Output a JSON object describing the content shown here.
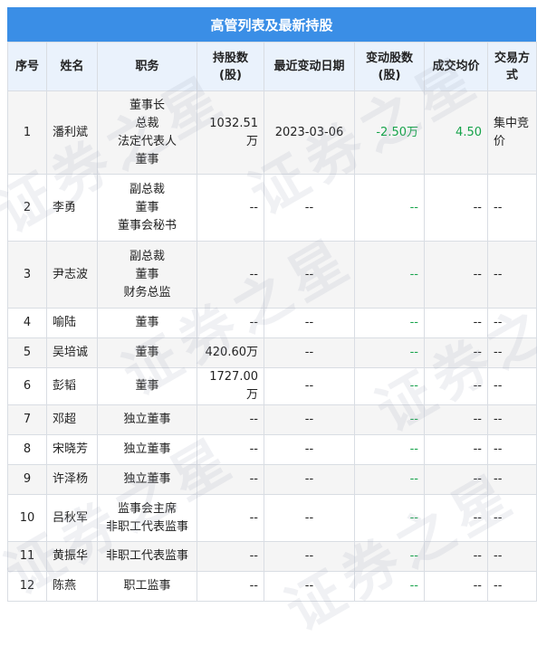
{
  "title": "高管列表及最新持股",
  "headers": {
    "idx": "序号",
    "name": "姓名",
    "position": "职务",
    "holding_l1": "持股数",
    "holding_l2": "(股)",
    "date": "最近变动日期",
    "change_l1": "变动股数",
    "change_l2": "(股)",
    "price": "成交均价",
    "method": "交易方式"
  },
  "rows": [
    {
      "idx": "1",
      "name": "潘利斌",
      "positions": [
        "董事长",
        "总裁",
        "法定代表人",
        "董事"
      ],
      "holding": "1032.51万",
      "date": "2023-03-06",
      "change": "-2.50万",
      "price": "4.50",
      "method": "集中竞价"
    },
    {
      "idx": "2",
      "name": "李勇",
      "positions": [
        "副总裁",
        "董事",
        "董事会秘书"
      ],
      "holding": "--",
      "date": "--",
      "change": "--",
      "price": "--",
      "method": "--"
    },
    {
      "idx": "3",
      "name": "尹志波",
      "positions": [
        "副总裁",
        "董事",
        "财务总监"
      ],
      "holding": "--",
      "date": "--",
      "change": "--",
      "price": "--",
      "method": "--"
    },
    {
      "idx": "4",
      "name": "喻陆",
      "positions": [
        "董事"
      ],
      "holding": "--",
      "date": "--",
      "change": "--",
      "price": "--",
      "method": "--"
    },
    {
      "idx": "5",
      "name": "吴培诚",
      "positions": [
        "董事"
      ],
      "holding": "420.60万",
      "date": "--",
      "change": "--",
      "price": "--",
      "method": "--"
    },
    {
      "idx": "6",
      "name": "彭韬",
      "positions": [
        "董事"
      ],
      "holding": "1727.00万",
      "date": "--",
      "change": "--",
      "price": "--",
      "method": "--"
    },
    {
      "idx": "7",
      "name": "邓超",
      "positions": [
        "独立董事"
      ],
      "holding": "--",
      "date": "--",
      "change": "--",
      "price": "--",
      "method": "--"
    },
    {
      "idx": "8",
      "name": "宋晓芳",
      "positions": [
        "独立董事"
      ],
      "holding": "--",
      "date": "--",
      "change": "--",
      "price": "--",
      "method": "--"
    },
    {
      "idx": "9",
      "name": "许泽杨",
      "positions": [
        "独立董事"
      ],
      "holding": "--",
      "date": "--",
      "change": "--",
      "price": "--",
      "method": "--"
    },
    {
      "idx": "10",
      "name": "吕秋军",
      "positions": [
        "监事会主席",
        "非职工代表监事"
      ],
      "holding": "--",
      "date": "--",
      "change": "--",
      "price": "--",
      "method": "--"
    },
    {
      "idx": "11",
      "name": "黄振华",
      "positions": [
        "非职工代表监事"
      ],
      "holding": "--",
      "date": "--",
      "change": "--",
      "price": "--",
      "method": "--"
    },
    {
      "idx": "12",
      "name": "陈燕",
      "positions": [
        "职工监事"
      ],
      "holding": "--",
      "date": "--",
      "change": "--",
      "price": "--",
      "method": "--"
    }
  ],
  "watermark": "证券之星",
  "colors": {
    "header_bar": "#3a8ee6",
    "header_row": "#eaf2fc",
    "negative": "#16a34a"
  }
}
